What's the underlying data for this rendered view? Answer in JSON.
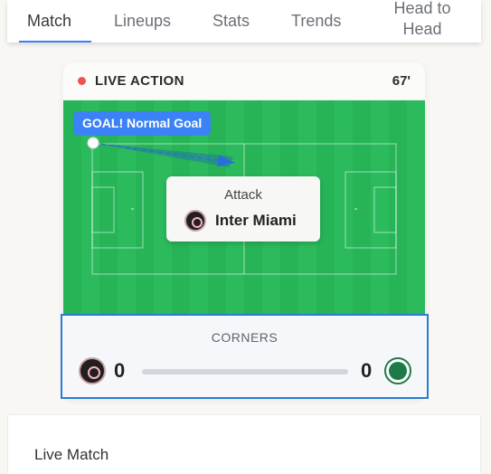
{
  "tabs": [
    {
      "label": "Match",
      "active": true
    },
    {
      "label": "Lineups",
      "active": false
    },
    {
      "label": "Stats",
      "active": false
    },
    {
      "label": "Trends",
      "active": false
    },
    {
      "label": "Head to\nHead",
      "active": false
    }
  ],
  "live": {
    "title": "LIVE ACTION",
    "minute": "67'",
    "event_label": "GOAL! Normal Goal",
    "attack_label": "Attack",
    "attacking_team": "Inter Miami"
  },
  "corners": {
    "title": "CORNERS",
    "home_score": "0",
    "away_score": "0",
    "home_logo": "inter-miami-logo",
    "away_logo": "palmeiras-logo"
  },
  "section": {
    "title": "Live Match"
  },
  "colors": {
    "accent": "#3b82f6",
    "pitch": "#27b457",
    "live_dot": "#ef5350",
    "highlight_border": "#2a7bd4"
  }
}
